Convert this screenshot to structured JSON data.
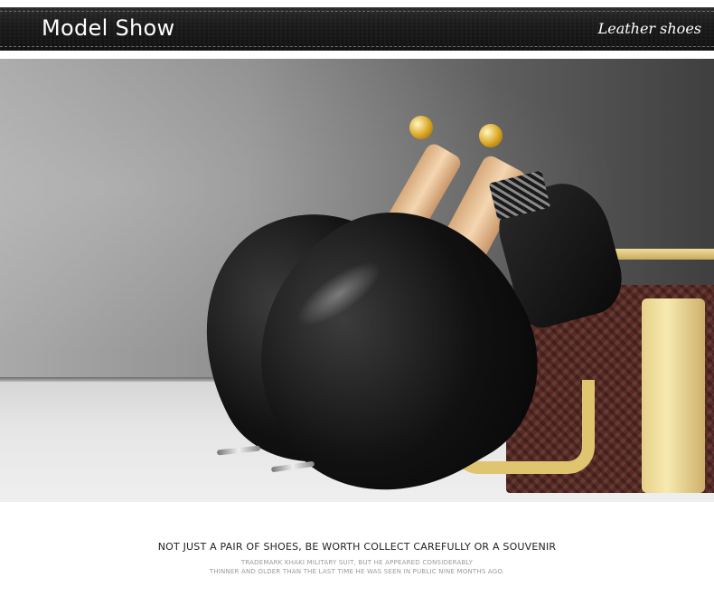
{
  "header": {
    "title": "Model Show",
    "subtitle": "Leather shoes"
  },
  "photo": {
    "description_icon": "shoe-photo"
  },
  "caption": {
    "main": "NOT JUST A PAIR OF SHOES, BE WORTH COLLECT CAREFULLY OR A SOUVENIR",
    "line1": "TRADEMARK KHAKI MILITARY SUIT, BUT HE APPEARED CONSIDERABLY",
    "line2": "THINNER AND OLDER THAN THE LAST TIME HE WAS SEEN IN PUBLIC NINE MONTHS AGO."
  },
  "colors": {
    "header_bg": "#1a1a1a",
    "header_text": "#ffffff",
    "caption_text": "#222222",
    "subcaption_text": "#9a9a9a"
  }
}
